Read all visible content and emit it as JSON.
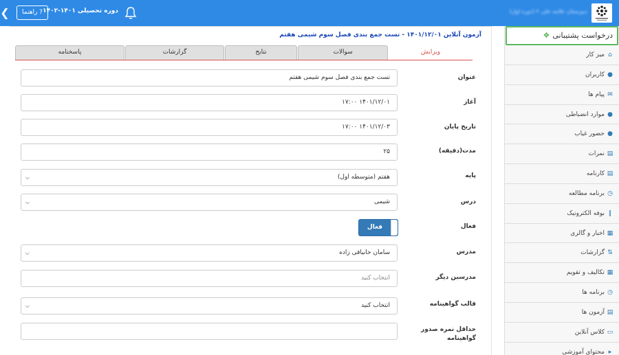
{
  "header": {
    "help_label": "? راهنما",
    "period_label": "دوره تحصیلی ۱۴۰۱-۱۴۰۲",
    "school_name": "دبیرستان علامه حلی ۲ (دوره اول)"
  },
  "sidebar": {
    "support_label": "درخواست پشتیبانی",
    "items": [
      {
        "label": "میز کار",
        "icon": "home-icon"
      },
      {
        "label": "کاربران",
        "icon": "user-icon"
      },
      {
        "label": "پیام ها",
        "icon": "envelope-icon"
      },
      {
        "label": "موارد انضباطی",
        "icon": "users-icon"
      },
      {
        "label": "حضور غیاب",
        "icon": "users-icon"
      },
      {
        "label": "نمرات",
        "icon": "chart-icon"
      },
      {
        "label": "کارنامه",
        "icon": "list-icon"
      },
      {
        "label": "برنامه مطالعه",
        "icon": "clock-icon"
      },
      {
        "label": "بوفه الکترونیک",
        "icon": "cutlery-icon"
      },
      {
        "label": "اخبار و گالری",
        "icon": "film-icon"
      },
      {
        "label": "گزارشات",
        "icon": "sort-icon"
      },
      {
        "label": "تکالیف و تقویم",
        "icon": "calendar-icon"
      },
      {
        "label": "برنامه ها",
        "icon": "clock-icon"
      },
      {
        "label": "آزمون ها",
        "icon": "list-icon"
      },
      {
        "label": "کلاس آنلاین",
        "icon": "monitor-icon"
      },
      {
        "label": "محتوای آموزشی",
        "icon": "megaphone-icon"
      }
    ]
  },
  "breadcrumb": "آزمون آنلاین ۱۴۰۱/۱۲/۰۱ - تست جمع بندی فصل سوم شیمی هفتم",
  "tabs": [
    "ویرایش",
    "سوالات",
    "نتایج",
    "گزارشات",
    "پاسخنامه"
  ],
  "form": {
    "title_label": "عنوان",
    "title_value": "تست جمع بندی فصل سوم شیمی هفتم",
    "start_label": "آغاز",
    "start_value": "۱۴۰۱/۱۲/۰۱ ۱۷:۰۰",
    "end_label": "تاریخ پایان",
    "end_value": "۱۴۰۱/۱۲/۰۳ ۱۷:۰۰",
    "duration_label": "مدت(دقیقه)",
    "duration_value": "۲۵",
    "grade_label": "پایه",
    "grade_value": "هفتم (متوسطه اول)",
    "course_label": "درس",
    "course_value": "شیمی",
    "active_label": "فعال",
    "active_toggle_label": "فعال",
    "active_state": true,
    "teacher_label": "مدرس",
    "teacher_value": "سامان خانیاقی زاده",
    "other_teachers_label": "مدرسین دیگر",
    "other_teachers_placeholder": "انتخاب کنید",
    "certificate_label": "قالب گواهینامه",
    "certificate_value": "انتخاب کنید",
    "min_score_label": "حداقل نمره صدور گواهینامه",
    "min_score_value": ""
  },
  "colors": {
    "header_bg": "#2f8ae6",
    "active_tab": "#d9534f",
    "toggle_bg": "#337ab7",
    "support_border": "#5cb85c"
  }
}
